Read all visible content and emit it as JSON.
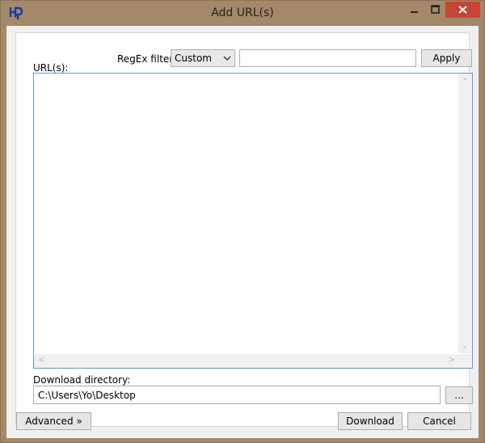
{
  "window": {
    "title": "Add URL(s)"
  },
  "filter": {
    "label": "RegEx filter:",
    "selected": "Custom",
    "pattern_value": "",
    "apply_label": "Apply"
  },
  "urls": {
    "label": "URL(s):",
    "value": ""
  },
  "download": {
    "label": "Download directory:",
    "path": "C:\\Users\\Yo\\Desktop",
    "browse_label": "..."
  },
  "footer": {
    "advanced_label": "Advanced »",
    "download_label": "Download",
    "cancel_label": "Cancel"
  },
  "colors": {
    "accent": "#569de5",
    "close": "#c74436",
    "frame": "#a3896a"
  }
}
